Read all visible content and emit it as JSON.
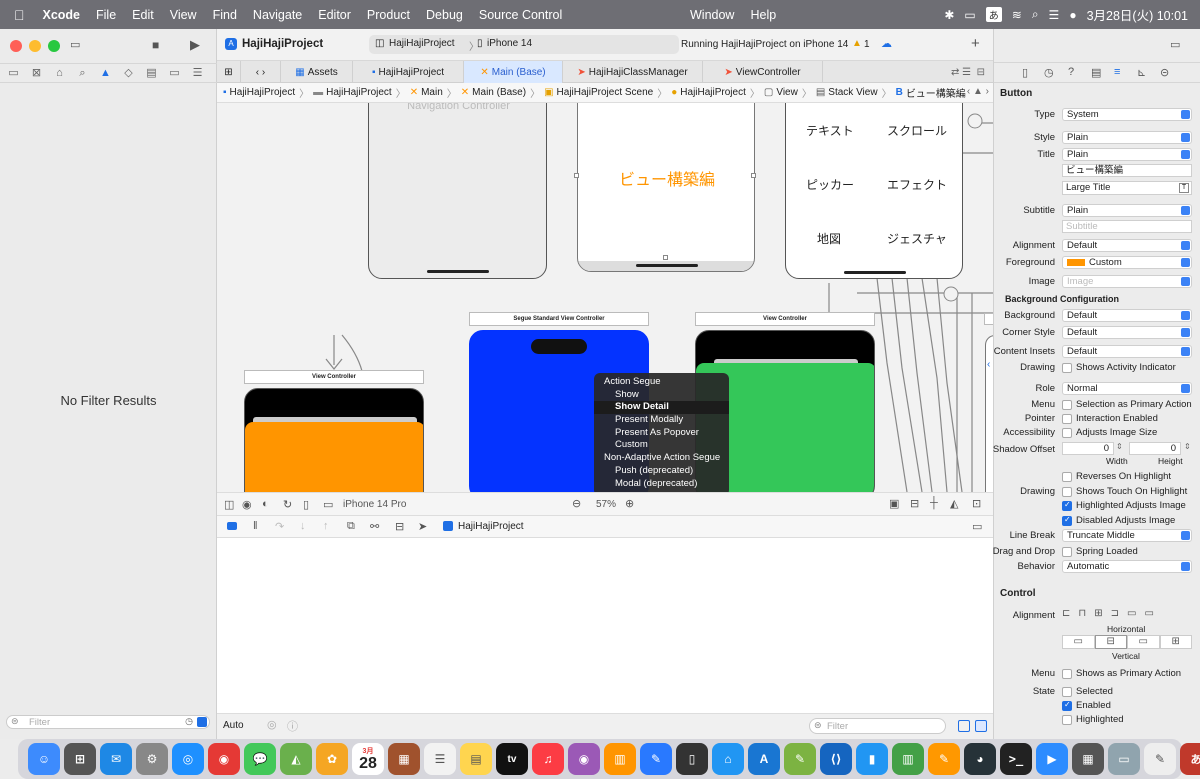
{
  "menubar": {
    "apple": "",
    "app": "Xcode",
    "items": [
      "File",
      "Edit",
      "View",
      "Find",
      "Navigate",
      "Editor",
      "Product",
      "Debug",
      "Source Control"
    ],
    "window_menu": "Window",
    "help_menu": "Help",
    "input_method": "あ",
    "datetime": "3月28日(火)  10:01"
  },
  "window": {
    "project_title": "HajiHajiProject",
    "scheme": "HajiHajiProject",
    "device": "iPhone 14",
    "status": "Running HajiHajiProject on iPhone 14",
    "warning_count": "1"
  },
  "navigator": {
    "empty_message": "No Filter Results",
    "filter_placeholder": "Filter"
  },
  "tabs": [
    "Assets",
    "HajiHajiProject",
    "Main (Base)",
    "HajiHajiClassManager",
    "ViewController"
  ],
  "jumpbar": [
    "HajiHajiProject",
    "HajiHajiProject",
    "Main",
    "Main (Base)",
    "HajiHajiProject Scene",
    "HajiHajiProject",
    "View",
    "Stack View",
    "ビュー構築編"
  ],
  "canvas": {
    "nav_controller_label": "Navigation Controller",
    "orange_title": "ビュー構築編",
    "grid_buttons": [
      "テキスト",
      "スクロール",
      "ピッカー",
      "エフェクト",
      "地図",
      "ジェスチャ"
    ],
    "segue_scene_label": "Segue Standard View Controller",
    "vc_label_1": "View Controller",
    "vc_label_2": "View Controller",
    "device_preview": "iPhone 14 Pro",
    "zoom": "57%",
    "colors": {
      "orange": "#ff9500",
      "blue": "#0433ff",
      "green": "#34c759"
    }
  },
  "segue_menu": {
    "header1": "Action Segue",
    "action_items": [
      "Show",
      "Show Detail",
      "Present Modally",
      "Present As Popover",
      "Custom"
    ],
    "header2": "Non-Adaptive Action Segue",
    "nonadaptive_items": [
      "Push (deprecated)",
      "Modal (deprecated)"
    ],
    "selected": "Show Detail"
  },
  "debugbar": {
    "target": "HajiHajiProject"
  },
  "console": {
    "scope": "Auto",
    "filter_placeholder": "Filter"
  },
  "inspector": {
    "section_button": "Button",
    "type_label": "Type",
    "type_value": "System",
    "style_label": "Style",
    "style_value": "Plain",
    "title_label": "Title",
    "title_value": "Plain",
    "title_text": "ビュー構築編",
    "title_font": "Large Title",
    "subtitle_label": "Subtitle",
    "subtitle_value": "Plain",
    "subtitle_placeholder": "Subtitle",
    "alignment_label": "Alignment",
    "alignment_value": "Default",
    "foreground_label": "Foreground",
    "foreground_value": "Custom",
    "image_label": "Image",
    "image_placeholder": "Image",
    "bg_config": "Background Configuration",
    "background_label": "Background",
    "background_value": "Default",
    "corner_label": "Corner Style",
    "corner_value": "Default",
    "insets_label": "Content Insets",
    "insets_value": "Default",
    "drawing_label": "Drawing",
    "drawing_check": "Shows Activity Indicator",
    "role_label": "Role",
    "role_value": "Normal",
    "menu_label": "Menu",
    "menu_check": "Selection as Primary Action",
    "pointer_label": "Pointer",
    "pointer_check": "Interaction Enabled",
    "accessibility_label": "Accessibility",
    "accessibility_check": "Adjusts Image Size",
    "shadow_label": "Shadow Offset",
    "shadow_w": "0",
    "shadow_h": "0",
    "width_label": "Width",
    "height_label": "Height",
    "reverses_check": "Reverses On Highlight",
    "drawing2_label": "Drawing",
    "touch_check": "Shows Touch On Highlight",
    "highlighted_adjusts": "Highlighted Adjusts Image",
    "disabled_adjusts": "Disabled Adjusts Image",
    "linebreak_label": "Line Break",
    "linebreak_value": "Truncate Middle",
    "dragdrop_label": "Drag and Drop",
    "dragdrop_check": "Spring Loaded",
    "behavior_label": "Behavior",
    "behavior_value": "Automatic",
    "section_control": "Control",
    "ctrl_alignment_label": "Alignment",
    "horizontal_label": "Horizontal",
    "vertical_label": "Vertical",
    "ctrl_menu_label": "Menu",
    "ctrl_menu_check": "Shows as Primary Action",
    "state_label": "State",
    "state_selected": "Selected",
    "state_enabled": "Enabled",
    "state_highlighted": "Highlighted",
    "accent_color": "#ff9500"
  },
  "dock": {
    "calendar_month": "3月",
    "calendar_day": "28",
    "tv_label": "tv",
    "ime_label": "あ"
  }
}
